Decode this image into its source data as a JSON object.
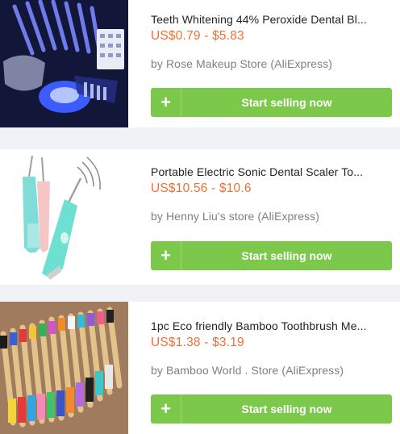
{
  "products": [
    {
      "title": "Teeth Whitening 44% Peroxide Dental Bl...",
      "price": "US$0.79 - $5.83",
      "store": "by Rose Makeup Store (AliExpress)",
      "button_icon": "+",
      "button_label": "Start selling now",
      "image": "teeth-whitening-kit"
    },
    {
      "title": "Portable Electric Sonic Dental Scaler To...",
      "price": "US$10.56 - $10.6",
      "store": "by Henny Liu's store (AliExpress)",
      "button_icon": "+",
      "button_label": "Start selling now",
      "image": "sonic-dental-scaler"
    },
    {
      "title": "1pc Eco friendly Bamboo Toothbrush Me...",
      "price": "US$1.38 - $3.19",
      "store": "by Bamboo World . Store (AliExpress)",
      "button_icon": "+",
      "button_label": "Start selling now",
      "image": "bamboo-toothbrushes"
    }
  ],
  "colors": {
    "price": "#f26f34",
    "button": "#7cc84b",
    "background": "#f1f2f5"
  }
}
